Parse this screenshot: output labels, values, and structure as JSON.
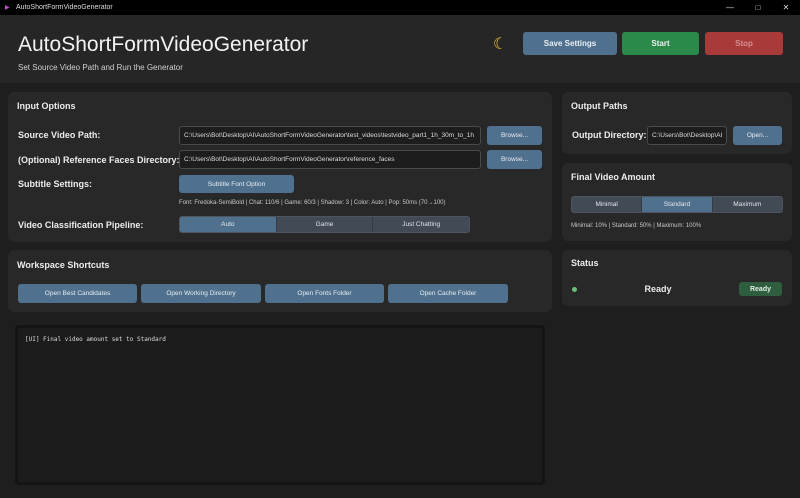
{
  "window": {
    "title": "AutoShortFormVideoGenerator"
  },
  "header": {
    "title": "AutoShortFormVideoGenerator",
    "subtitle": "Set Source Video Path and Run the Generator",
    "theme_icon": "moon-icon",
    "save_label": "Save Settings",
    "start_label": "Start",
    "stop_label": "Stop"
  },
  "input_options": {
    "title": "Input Options",
    "source_label": "Source Video Path:",
    "source_value": "C:\\Users\\Bot\\Desktop\\AI\\AutoShortFormVideoGenerator\\test_videos\\testvideo_part1_1h_30m_to_1h",
    "source_browse": "Browse...",
    "faces_label": "(Optional) Reference Faces Directory:",
    "faces_value": "C:\\Users\\Bot\\Desktop\\AI\\AutoShortFormVideoGenerator\\reference_faces",
    "faces_browse": "Browse...",
    "subtitle_label": "Subtitle Settings:",
    "subtitle_button": "Subtitle Font Option",
    "subtitle_info": "Font: Fredoka-SemiBold | Chat: 110/6 | Game: 60/3 | Shadow: 3 | Color: Auto | Pop: 50ms (70→100)",
    "pipeline_label": "Video Classification Pipeline:",
    "pipeline_options": [
      "Auto",
      "Game",
      "Just Chatting"
    ],
    "pipeline_selected": "Auto"
  },
  "shortcuts": {
    "title": "Workspace Shortcuts",
    "buttons": [
      "Open Best Candidates",
      "Open Working Directory",
      "Open Fonts Folder",
      "Open Cache Folder"
    ]
  },
  "log": {
    "lines": [
      "[UI] Final video amount set to Standard"
    ]
  },
  "output_paths": {
    "title": "Output Paths",
    "dir_label": "Output Directory:",
    "dir_value": "C:\\Users\\Bot\\Desktop\\AI",
    "open_label": "Open..."
  },
  "final_amount": {
    "title": "Final Video Amount",
    "options": [
      "Minimal",
      "Standard",
      "Maximum"
    ],
    "selected": "Standard",
    "info": "Minimal: 10% | Standard: 50% | Maximum: 100%"
  },
  "status": {
    "title": "Status",
    "text": "Ready",
    "badge": "Ready",
    "dot_color": "#67c07a"
  }
}
